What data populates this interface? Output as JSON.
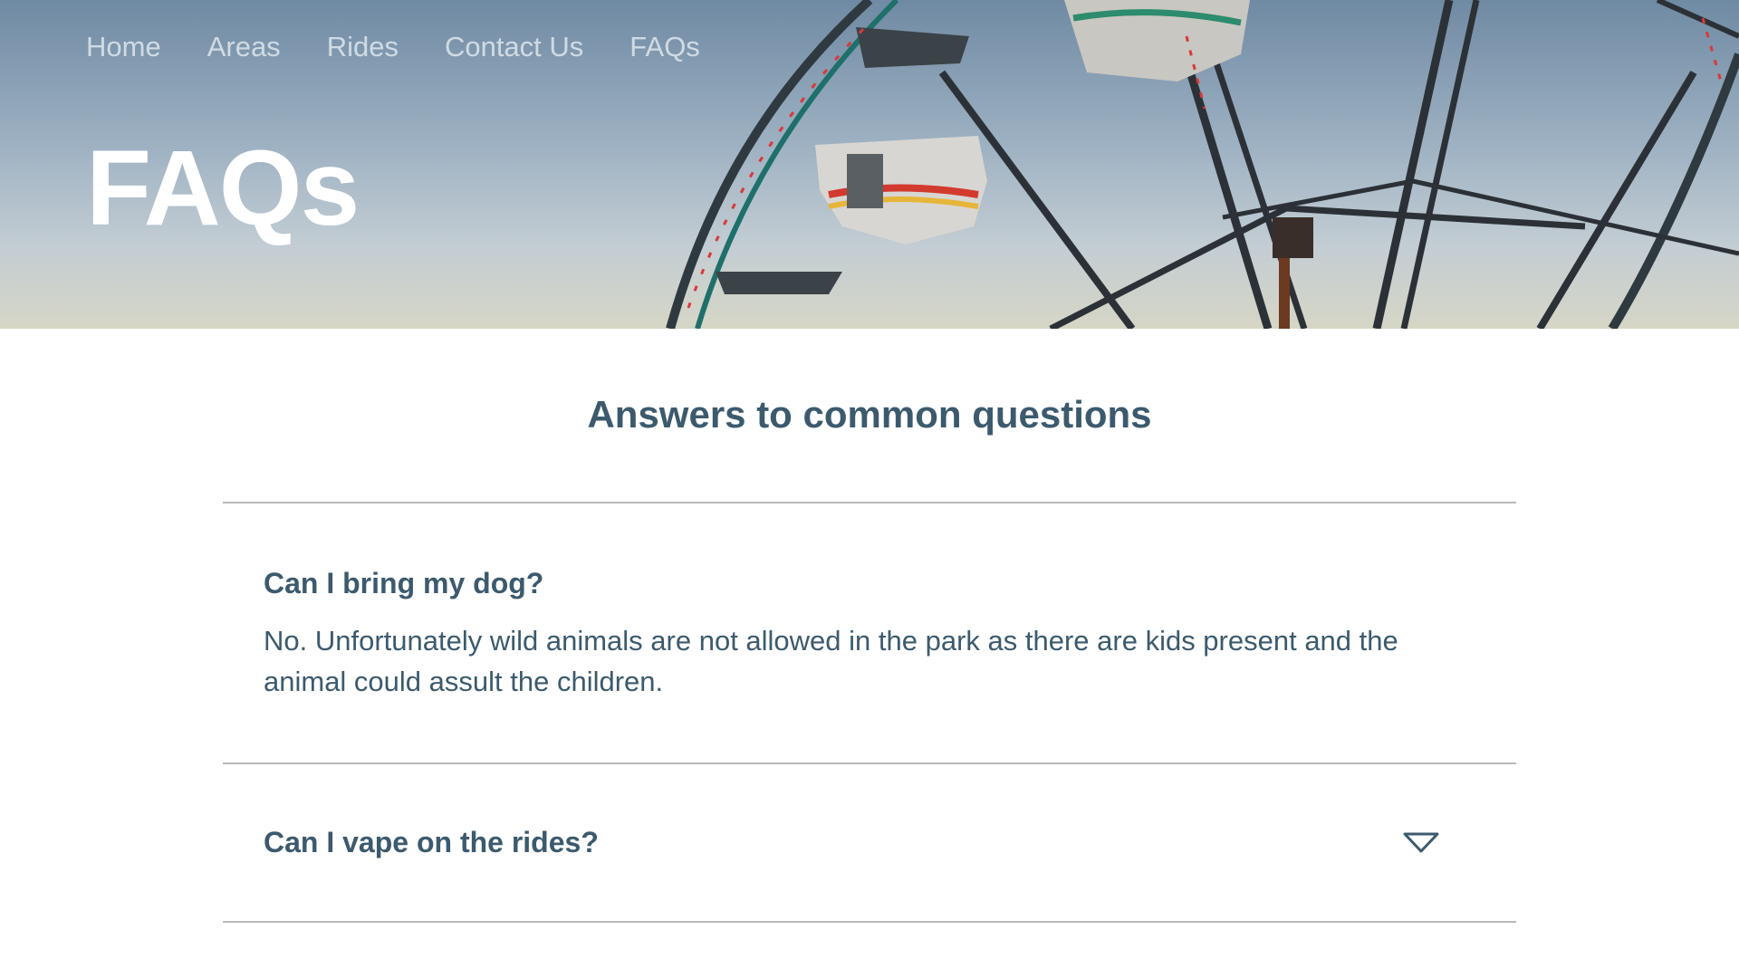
{
  "nav": {
    "items": [
      {
        "label": "Home"
      },
      {
        "label": "Areas"
      },
      {
        "label": "Rides"
      },
      {
        "label": "Contact Us"
      },
      {
        "label": "FAQs"
      }
    ]
  },
  "hero": {
    "title": "FAQs",
    "image": "ferris-wheel-photo"
  },
  "main": {
    "heading": "Answers to common questions",
    "faqs": [
      {
        "question": "Can I bring my dog?",
        "answer": "No. Unfortunately wild animals are not allowed in the park as there are kids present and the animal could assult the children.",
        "expanded": true
      },
      {
        "question": "Can I vape on the rides?",
        "expanded": false,
        "icon": "chevron-down-icon"
      }
    ]
  },
  "colors": {
    "heading_text": "#3c5a6e",
    "divider": "#b9b9b9",
    "nav_text": "#dfe7ee",
    "hero_title": "#ffffff"
  }
}
